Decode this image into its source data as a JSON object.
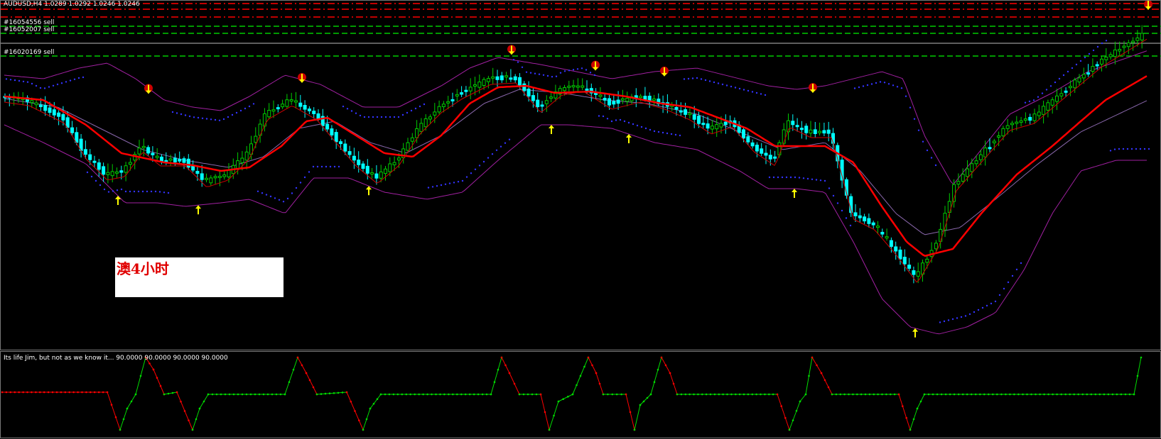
{
  "colors": {
    "bull": "#00cc00",
    "bear": "#00ffff",
    "ma_fast": "#ff0000",
    "bands": "#a020a0",
    "sar": "#3333ff",
    "osc_up": "#00dd00",
    "osc_down": "#ff0000",
    "level_lines": "#00cc00",
    "bid_lines": "#ff0000"
  },
  "header": {
    "symbol_line": "AUDUSD,H4 1.0289 1.0292 1.0246 1.0246"
  },
  "order_labels": [
    "#16054556 sell",
    "#16052007 sell",
    "#16020169 sell"
  ],
  "note": {
    "text": "澳4小时"
  },
  "oscillator": {
    "label": "Its life Jim, but not as we know it... 90.0000 90.0000 90.0000 90.0000"
  },
  "chart_data": [
    {
      "type": "candlestick",
      "title": "AUDUSD,H4",
      "indicators": [
        "moving averages",
        "bollinger bands",
        "parabolic SAR",
        "buy/sell arrows"
      ],
      "up_signal_candles": [
        26,
        44,
        82,
        123,
        140,
        176,
        203
      ],
      "down_signal_candles": [
        32,
        67,
        114,
        133,
        149,
        182,
        256
      ],
      "grid": false
    },
    {
      "type": "line",
      "title": "Its life Jim, but not as we know it...",
      "levels": [
        90.0
      ]
    }
  ]
}
